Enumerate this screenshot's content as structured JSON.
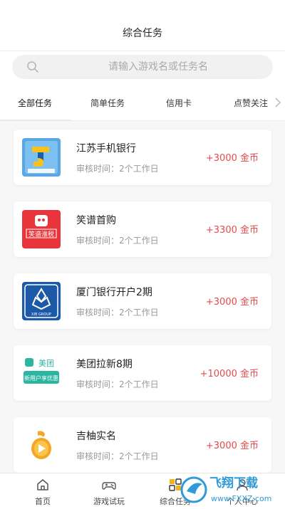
{
  "header": {
    "title": "综合任务"
  },
  "search": {
    "placeholder": "请输入游戏名或任务名"
  },
  "tabs": [
    {
      "label": "全部任务",
      "active": true
    },
    {
      "label": "简单任务"
    },
    {
      "label": "信用卡"
    },
    {
      "label": "点赞关注"
    }
  ],
  "tasks": [
    {
      "name": "江苏手机银行",
      "review": "审核时间：2个工作日",
      "reward": "+3000 金币",
      "logo": "jiangsu-bank-logo-icon"
    },
    {
      "name": "笑谱首购",
      "review": "审核时间：2个工作日",
      "reward": "+3300 金币",
      "logo": "xiaopu-logo-icon",
      "logo_text": "笑谱淮税"
    },
    {
      "name": "厦门银行开户2期",
      "review": "审核时间：2个工作日",
      "reward": "+3000 金币",
      "logo": "xiamen-bank-logo-icon",
      "logo_text": "XIB GROUP"
    },
    {
      "name": "美团拉新8期",
      "review": "审核时间：2个工作日",
      "reward": "+10000 金币",
      "logo": "meituan-logo-icon",
      "logo_text": "美团",
      "logo_text2": "新用户享优惠"
    },
    {
      "name": "吉柚实名",
      "review": "审核时间：2个工作日",
      "reward": "+3000 金币",
      "logo": "jiyou-logo-icon"
    }
  ],
  "bottom_nav": [
    {
      "label": "首页",
      "icon": "home-icon"
    },
    {
      "label": "游戏试玩",
      "icon": "gamepad-icon"
    },
    {
      "label": "综合任务",
      "icon": "tasks-icon"
    },
    {
      "label": "个人中心",
      "icon": "user-icon"
    }
  ],
  "watermark": {
    "text": "飞翔下载",
    "url_text": "www.FXXZ.com"
  },
  "colors": {
    "reward": "#e54b4b",
    "meituan": "#2bb6a0",
    "xiaopu": "#e8343a",
    "xiamen": "#1c5aa8",
    "jiyou": "#f5a623"
  }
}
